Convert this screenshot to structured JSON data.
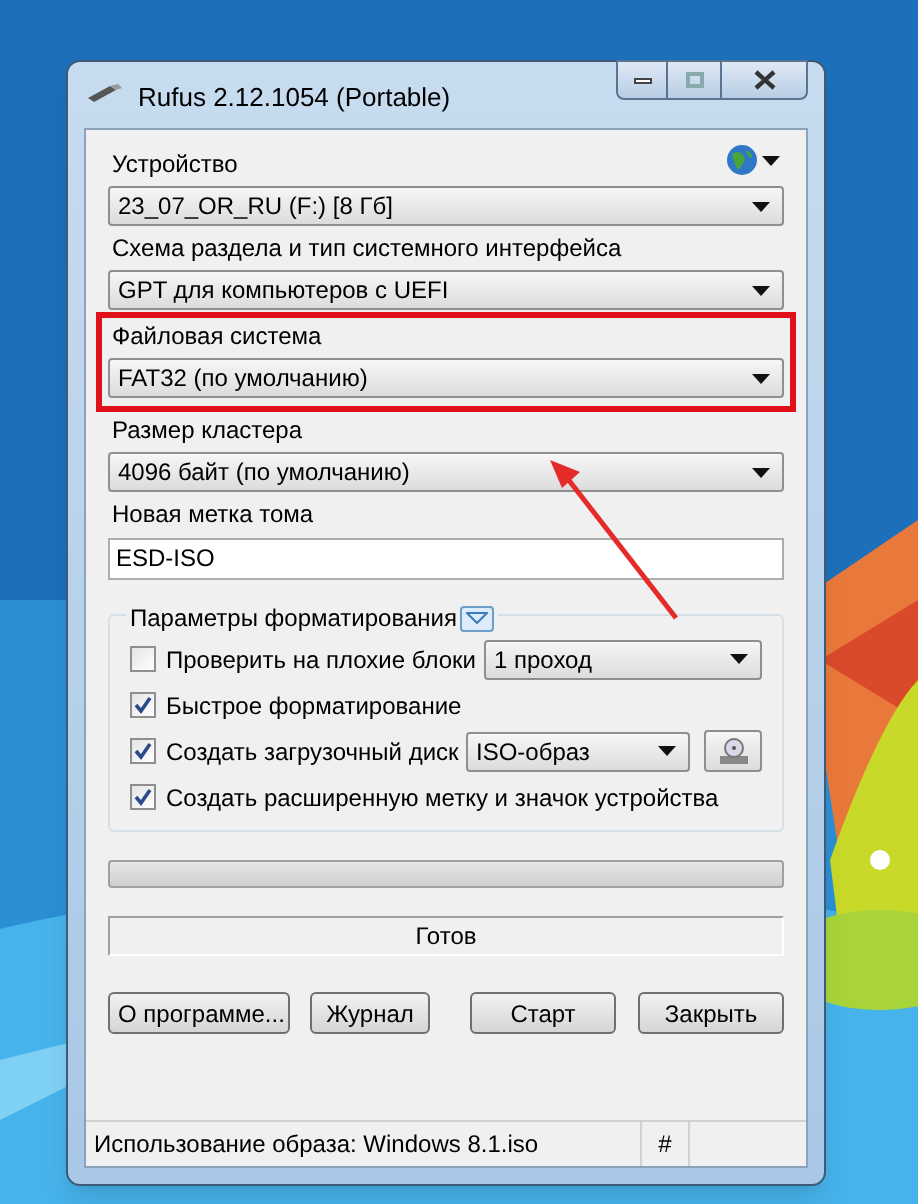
{
  "window": {
    "title": "Rufus 2.12.1054 (Portable)"
  },
  "device": {
    "label": "Устройство",
    "value": "23_07_OR_RU (F:) [8 Гб]"
  },
  "partition_scheme": {
    "label": "Схема раздела и тип системного интерфейса",
    "value": "GPT для компьютеров с UEFI"
  },
  "file_system": {
    "label": "Файловая система",
    "value": "FAT32 (по умолчанию)",
    "highlighted": true
  },
  "cluster_size": {
    "label": "Размер кластера",
    "value": "4096 байт (по умолчанию)"
  },
  "volume_label": {
    "label": "Новая метка тома",
    "value": "ESD-ISO"
  },
  "format_options": {
    "title": "Параметры форматирования",
    "options": [
      {
        "kind": "select",
        "label": "Проверить на плохие блоки",
        "checked": false,
        "value": "1 проход"
      },
      {
        "kind": "plain",
        "label": "Быстрое форматирование",
        "checked": true
      },
      {
        "label": "Создать загрузочный диск",
        "checked": true,
        "value": "ISO-образ"
      },
      {
        "kind": "plain",
        "label": "Создать расширенную метку и значок устройства",
        "checked": true
      }
    ]
  },
  "progress": {
    "level": 0
  },
  "status": "Готов",
  "buttons": [
    "О программе...",
    "Журнал",
    "Старт",
    "Закрыть"
  ],
  "status_bar": [
    "Использование образа: Windows 8.1.iso",
    "#"
  ]
}
